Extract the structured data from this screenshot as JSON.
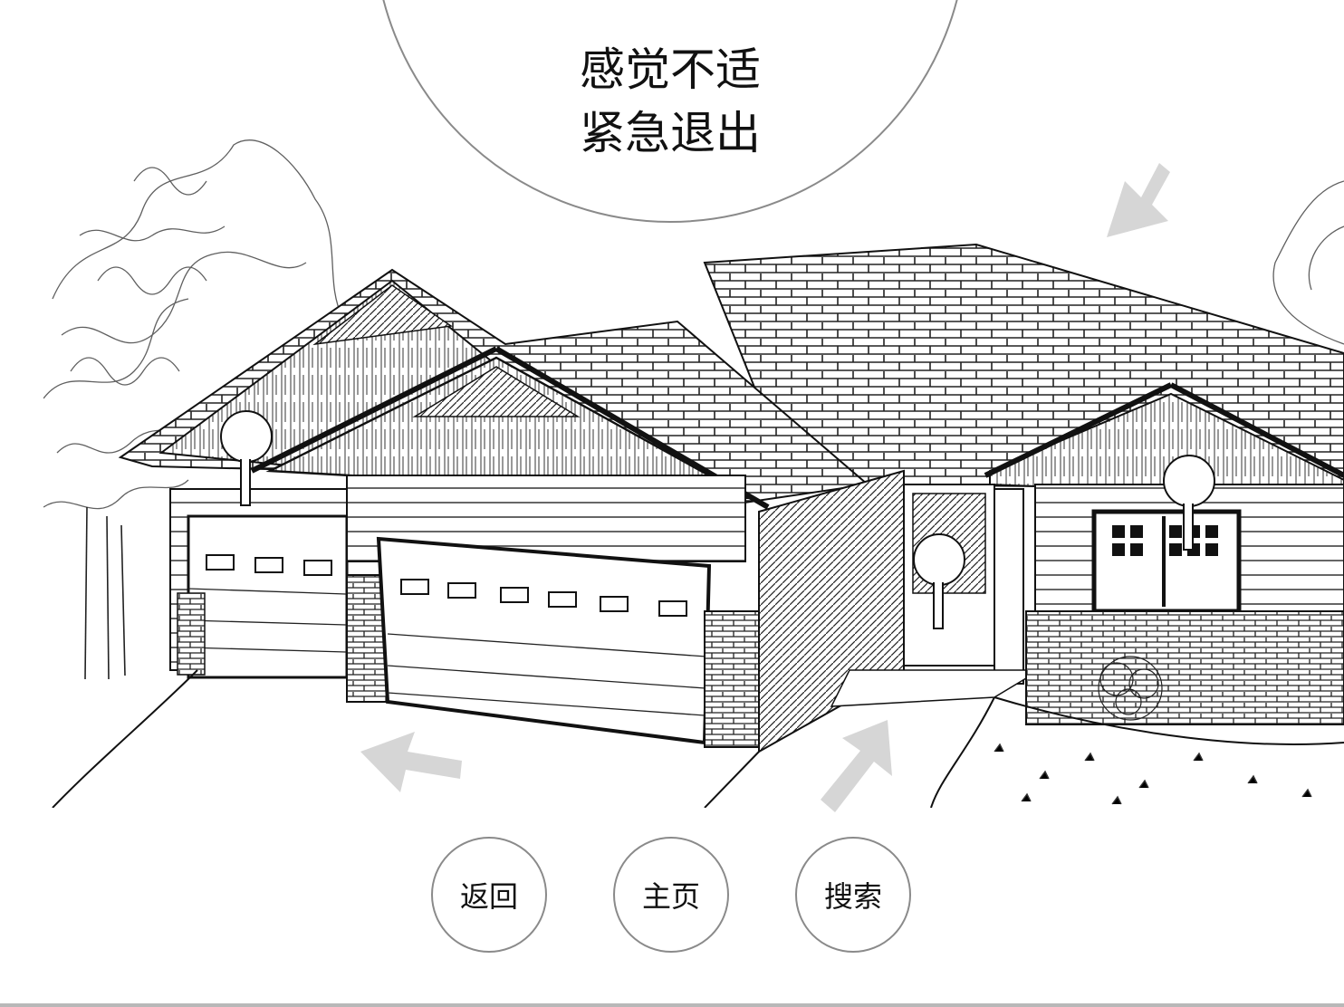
{
  "exit": {
    "line1": "感觉不适",
    "line2": "紧急退出"
  },
  "hotspots": [
    {
      "name": "hotspot-garage-roof"
    },
    {
      "name": "hotspot-front-door"
    },
    {
      "name": "hotspot-side-window"
    }
  ],
  "arrows": [
    {
      "name": "arrow-up-left",
      "icon": "arrow-icon"
    },
    {
      "name": "arrow-forward",
      "icon": "arrow-icon"
    },
    {
      "name": "arrow-down-left",
      "icon": "arrow-icon"
    }
  ],
  "buttons": {
    "back": "返回",
    "home": "主页",
    "search": "搜索"
  },
  "colors": {
    "arrow": "#d6d6d6",
    "stroke": "#111111",
    "circle_border": "#8a8a8a"
  }
}
